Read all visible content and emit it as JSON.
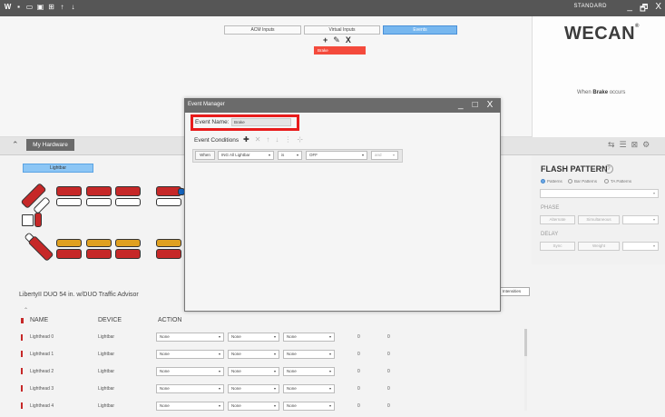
{
  "titlebar": {
    "mode": "STANDARD",
    "min": "_",
    "max": "🗗",
    "close": "X"
  },
  "top_tabs": [
    {
      "label": "ACM Inputs"
    },
    {
      "label": "Virtual Inputs"
    },
    {
      "label": "Events"
    }
  ],
  "toolbar": {
    "add": "+",
    "edit": "✎",
    "delete": "X"
  },
  "event_chip": "Brake",
  "brand": {
    "logo": "WECAN",
    "reg": "®",
    "when_prefix": "When",
    "when_event": "Brake",
    "when_suffix": "occurs"
  },
  "hardware": {
    "tab_label": "My Hardware",
    "lightbar_button": "Lightbar"
  },
  "flash_pattern": {
    "title": "FLASH PATTERN",
    "info": "?",
    "radios": [
      "Patterns",
      "Bar Patterns",
      "TA Patterns"
    ],
    "phase_label": "PHASE",
    "phase_buttons": [
      "Alternate",
      "Simultaneous"
    ],
    "delay_label": "DELAY",
    "delay_buttons": [
      "Sync",
      "Weight"
    ]
  },
  "product_title": "LibertyII DUO 54 in. w/DUO Traffic Advisor",
  "intensities_button": "Intensities",
  "table": {
    "headers": [
      "NAME",
      "DEVICE",
      "ACTION"
    ],
    "rows": [
      {
        "name": "Lighthead 0",
        "device": "Lightbar",
        "a1": "None",
        "a2": "None",
        "a3": "None",
        "v1": "0",
        "v2": "0"
      },
      {
        "name": "Lighthead 1",
        "device": "Lightbar",
        "a1": "None",
        "a2": "None",
        "a3": "None",
        "v1": "0",
        "v2": "0"
      },
      {
        "name": "Lighthead 2",
        "device": "Lightbar",
        "a1": "None",
        "a2": "None",
        "a3": "None",
        "v1": "0",
        "v2": "0"
      },
      {
        "name": "Lighthead 3",
        "device": "Lightbar",
        "a1": "None",
        "a2": "None",
        "a3": "None",
        "v1": "0",
        "v2": "0"
      },
      {
        "name": "Lighthead 4",
        "device": "Lightbar",
        "a1": "None",
        "a2": "None",
        "a3": "None",
        "v1": "0",
        "v2": "0"
      }
    ]
  },
  "dialog": {
    "title": "Event Manager",
    "min": "_",
    "max": "□",
    "close": "X",
    "event_name_label": "Event Name:",
    "event_name_value": "Brake",
    "conditions_label": "Event Conditions",
    "condition": {
      "when": "When",
      "source": "ING All Lightbar",
      "op": "is",
      "value": "OFF",
      "join": "and"
    }
  },
  "colors": {
    "accent": "#77b7ef",
    "alert_red": "#e81b1b",
    "chip_red": "#f44a3c"
  }
}
